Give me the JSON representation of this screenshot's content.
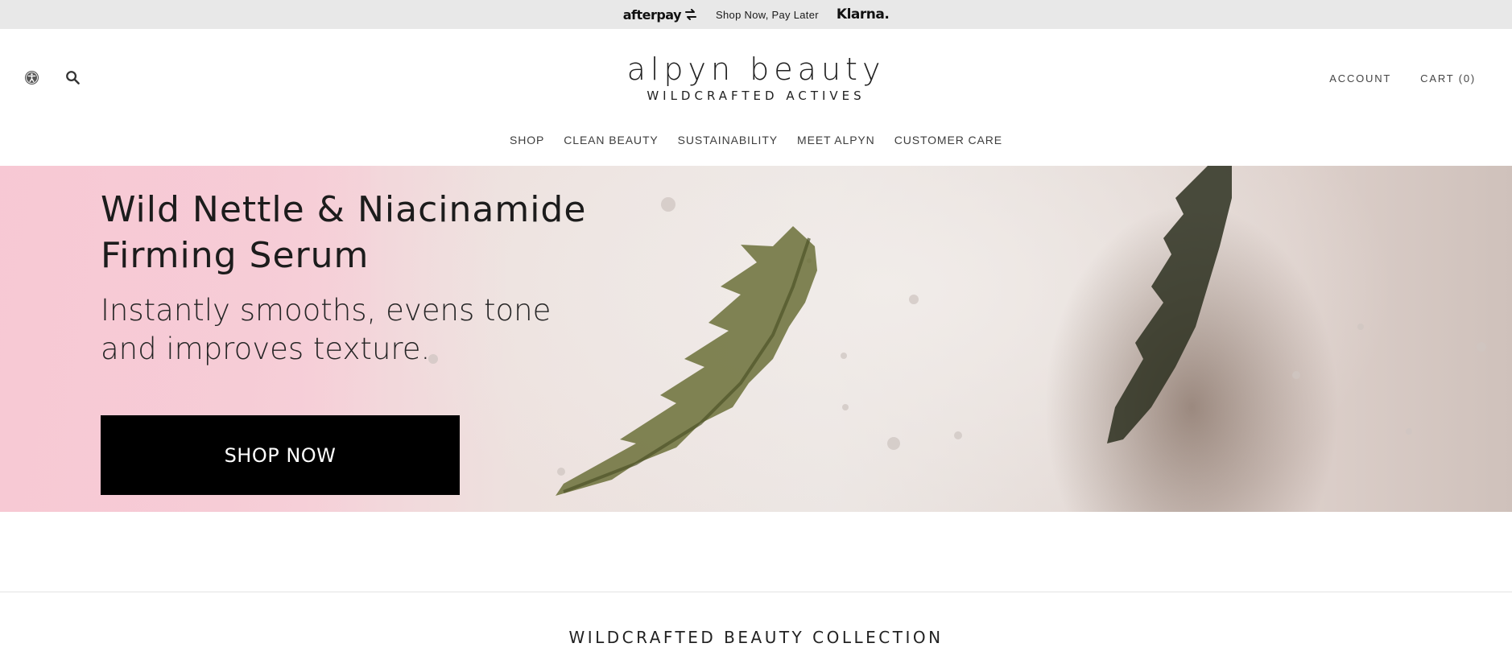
{
  "promo_bar": {
    "afterpay_logo": "afterpay",
    "text": "Shop Now, Pay Later",
    "klarna_logo": "Klarna."
  },
  "header": {
    "icons": [
      "accessibility-icon",
      "search-icon"
    ],
    "logo_main": "alpyn beauty",
    "logo_sub": "WILDCRAFTED ACTIVES",
    "account_label": "ACCOUNT",
    "cart_label": "CART (0)"
  },
  "nav": {
    "items": [
      "SHOP",
      "CLEAN BEAUTY",
      "SUSTAINABILITY",
      "MEET ALPYN",
      "CUSTOMER CARE"
    ]
  },
  "hero": {
    "title_line1": "Wild Nettle & Niacinamide",
    "title_line2": "Firming Serum",
    "subtitle_line1": "Instantly smooths, evens tone",
    "subtitle_line2": "and improves texture.",
    "button_label": "SHOP NOW"
  },
  "section": {
    "title": "WILDCRAFTED BEAUTY COLLECTION"
  },
  "colors": {
    "promo_bg": "#e8e8e8",
    "hero_pink": "#f7cdd6",
    "button_bg": "#000000",
    "button_text": "#ffffff"
  }
}
